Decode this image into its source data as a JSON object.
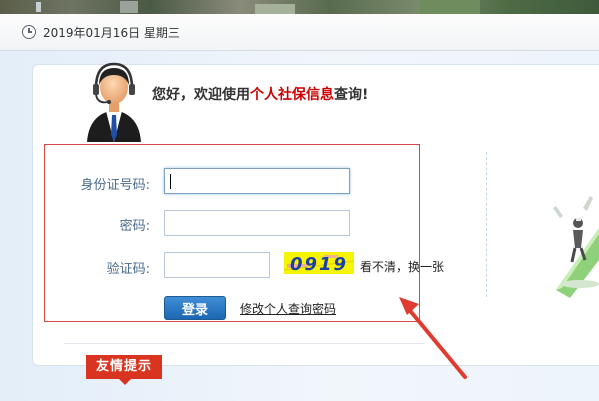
{
  "header": {
    "date_text": "2019年01月16日 星期三",
    "clock_icon": "clock-icon"
  },
  "welcome": {
    "prefix": "您好，欢迎使用",
    "highlight": "个人社保信息",
    "suffix": "查询!",
    "highlight_color": "#cc0000",
    "avatar_icon": "customer-service-avatar-icon"
  },
  "form": {
    "id_label": "身份证号码:",
    "id_value": "",
    "password_label": "密码:",
    "password_value": "",
    "captcha_label": "验证码:",
    "captcha_value": "",
    "captcha_code": "0919",
    "refresh_captcha": "看不清，换一张",
    "login_button": "登录",
    "change_password_link": "修改个人查询密码"
  },
  "tips": {
    "title": "友情提示"
  },
  "colors": {
    "accent_red": "#d94848",
    "button_blue": "#2a76c2",
    "label_blue": "#4a6a8c",
    "tip_tab_red": "#d9341f",
    "captcha_yellow": "#f6f400",
    "captcha_digits": "#1a3fa8"
  }
}
